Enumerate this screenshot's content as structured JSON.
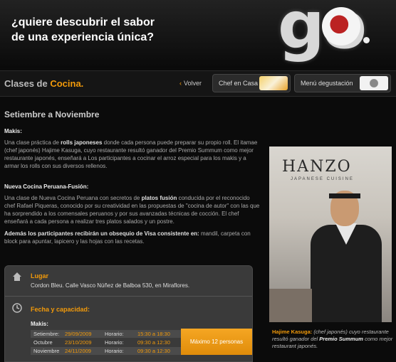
{
  "header": {
    "tagline_line1": "¿quiere descubrir el sabor",
    "tagline_line2": "de una experiencia única?",
    "logo_text": "go"
  },
  "titlebar": {
    "title_plain": "Clases de ",
    "title_accent": "Cocina.",
    "back_label": "Volver",
    "tab_chef": "Chef en Casa",
    "tab_menu": "Menú degustación"
  },
  "content": {
    "period": "Setiembre a Noviembre",
    "makis_heading": "Makis:",
    "makis_p1": "Una clase práctica de ",
    "makis_bold": "rolls japoneses",
    "makis_p2": " donde cada persona puede preparar su propio roll. El itamae (chef japonés) Hajime Kasuga, cuyo restaurante resultó ganador del Premio Summum como mejor restaurante japonés, enseñará a Los participantes a cocinar el arroz especial para los makis y a armar los rolls con sus diversos rellenos.",
    "fusion_heading": "Nueva Cocina Peruana-Fusión:",
    "fusion_p1": "Una clase de Nueva Cocina Peruana con secretos de ",
    "fusion_bold": "platos fusión",
    "fusion_p2": " conducida por el reconocido chef Rafael Piqueras, conocido por su creatividad en las propuestas de \"cocina de autor\" con las que ha sorprendido a los comensales peruanos y por sus avanzadas técnicas de cocción. El chef enseñará a cada persona a realizar tres platos salados y un postre.",
    "gift_bold": "Además los participantes recibirán un obsequio de Visa consistente en:",
    "gift_text": " mandil, carpeta con block para apuntar, lapicero y las hojas con las recetas."
  },
  "photo": {
    "sign_text": "HANZO",
    "sign_sub": "JAPANESE CUISINE",
    "caption_name": "Hajime Kasuga:",
    "caption_p1": " (chef japonés) cuyo restaurante resultó ganador del ",
    "caption_bold": "Premio Summum",
    "caption_p2": " como mejor restaurant japonés."
  },
  "info": {
    "place_title": "Lugar",
    "place_text": "Cordon Bleu. Calle Vasco Núñez de Balboa 530, en Miraflores.",
    "date_title": "Fecha y capacidad:",
    "makis_label": "Makis:",
    "schedule": [
      {
        "mes": "Setiembre:",
        "fecha": "29/09/2009",
        "hlabel": "Horario:",
        "hora": "15:30 a 18:30"
      },
      {
        "mes": "Octubre",
        "fecha": "23/10/2009",
        "hlabel": "Horario:",
        "hora": "09:30 a 12:30"
      },
      {
        "mes": "Noviembre",
        "fecha": "24/11/2009",
        "hlabel": "Horario:",
        "hora": "09:30 a 12:30"
      }
    ],
    "capacity": "Máximo 12 personas"
  },
  "colors": {
    "accent": "#f29a0a",
    "background": "#0b0b0b"
  }
}
